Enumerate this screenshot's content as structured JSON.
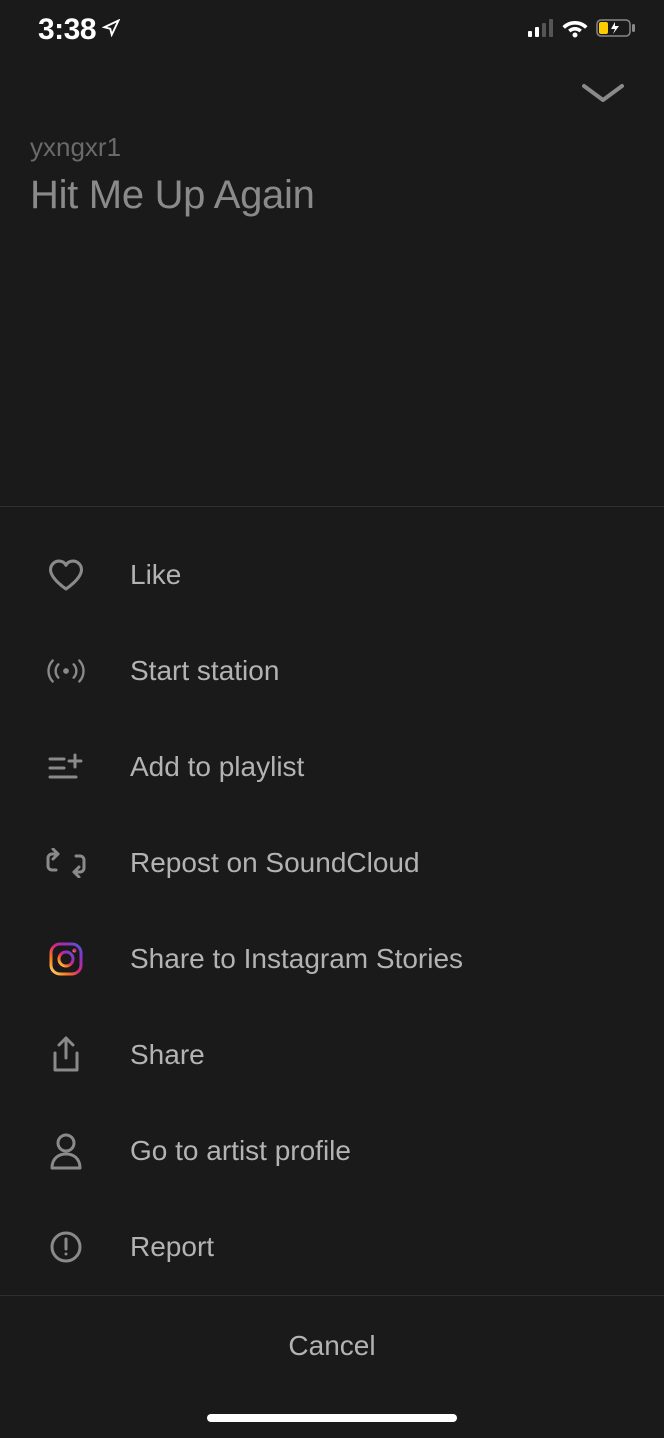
{
  "status_bar": {
    "time": "3:38"
  },
  "header": {
    "artist": "yxngxr1",
    "track_title": "Hit Me Up Again"
  },
  "menu": {
    "items": [
      {
        "label": "Like",
        "icon": "heart-icon"
      },
      {
        "label": "Start station",
        "icon": "station-icon"
      },
      {
        "label": "Add to playlist",
        "icon": "add-playlist-icon"
      },
      {
        "label": "Repost on SoundCloud",
        "icon": "repost-icon"
      },
      {
        "label": "Share to Instagram Stories",
        "icon": "instagram-icon"
      },
      {
        "label": "Share",
        "icon": "share-icon"
      },
      {
        "label": "Go to artist profile",
        "icon": "profile-icon"
      },
      {
        "label": "Report",
        "icon": "report-icon"
      }
    ]
  },
  "footer": {
    "cancel_label": "Cancel"
  }
}
